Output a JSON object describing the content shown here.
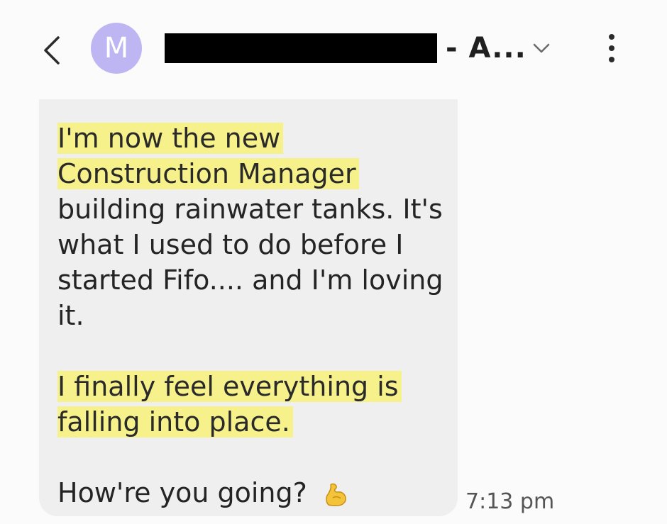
{
  "header": {
    "avatar_letter": "M",
    "contact_name_suffix": "- A...",
    "icons": {
      "back": "back-chevron-icon",
      "expand": "chevron-down-icon",
      "more": "more-vertical-icon"
    }
  },
  "message": {
    "lines": [
      "I'm now the new",
      "Construction Manager",
      "building rainwater tanks. It's",
      "what I used to do before I",
      "started Fifo.... and I'm loving",
      "it.",
      "I finally feel everything is",
      "falling into place.",
      "How're you going?"
    ],
    "emoji": "flexed-biceps-icon",
    "highlight_color": "#f6f18a",
    "bubble_color": "#efefef",
    "timestamp": "7:13 pm"
  },
  "colors": {
    "avatar_bg": "#bdb6f2",
    "redaction": "#000000"
  }
}
